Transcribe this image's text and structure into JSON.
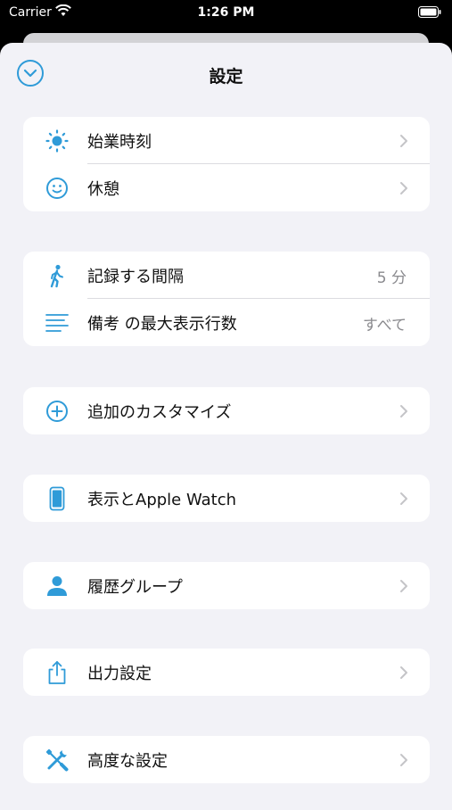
{
  "status_bar": {
    "carrier": "Carrier",
    "time": "1:26 PM"
  },
  "nav": {
    "title": "設定"
  },
  "accent_color": "#2f9bd8",
  "groups": [
    {
      "rows": [
        {
          "label": "始業時刻",
          "icon": "sun-icon",
          "accessory": "chevron"
        },
        {
          "label": "休憩",
          "icon": "smiley-icon",
          "accessory": "chevron"
        }
      ]
    },
    {
      "rows": [
        {
          "label": "記録する間隔",
          "icon": "walking-person-icon",
          "value": "5 分"
        },
        {
          "label": "備考 の最大表示行数",
          "icon": "lines-icon",
          "value": "すべて"
        }
      ]
    },
    {
      "rows": [
        {
          "label": "追加のカスタマイズ",
          "icon": "plus-circle-icon",
          "accessory": "chevron"
        }
      ]
    },
    {
      "rows": [
        {
          "label": "表示とApple Watch",
          "icon": "phone-icon",
          "accessory": "chevron"
        }
      ]
    },
    {
      "rows": [
        {
          "label": "履歴グループ",
          "icon": "person-icon",
          "accessory": "chevron"
        }
      ]
    },
    {
      "rows": [
        {
          "label": "出力設定",
          "icon": "share-icon",
          "accessory": "chevron"
        }
      ]
    },
    {
      "rows": [
        {
          "label": "高度な設定",
          "icon": "tools-icon",
          "accessory": "chevron"
        }
      ]
    }
  ]
}
